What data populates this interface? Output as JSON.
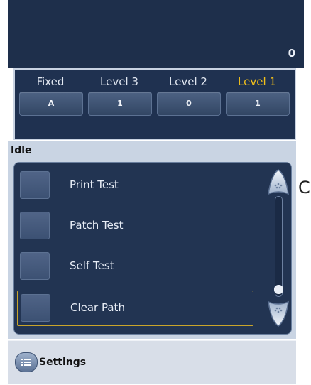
{
  "counter": "0",
  "levels": [
    {
      "label": "Fixed",
      "value": "A",
      "active": false
    },
    {
      "label": "Level 3",
      "value": "1",
      "active": false
    },
    {
      "label": "Level 2",
      "value": "0",
      "active": false
    },
    {
      "label": "Level 1",
      "value": "1",
      "active": true
    }
  ],
  "status": "Idle",
  "tests": [
    {
      "label": "Print Test"
    },
    {
      "label": "Patch Test"
    },
    {
      "label": "Self Test"
    },
    {
      "label": "Clear Path"
    }
  ],
  "selected_test": "Clear Path",
  "scroll_position": 0.9,
  "footer": {
    "settings_label": "Settings",
    "settings_icon": "list-icon"
  },
  "edge_glyph": "C",
  "colors": {
    "background": "#1e2f4b",
    "panel": "#223452",
    "active_level": "#f3c01a",
    "highlight_border": "#caa52a",
    "status_bar": "#c9d4e3"
  }
}
